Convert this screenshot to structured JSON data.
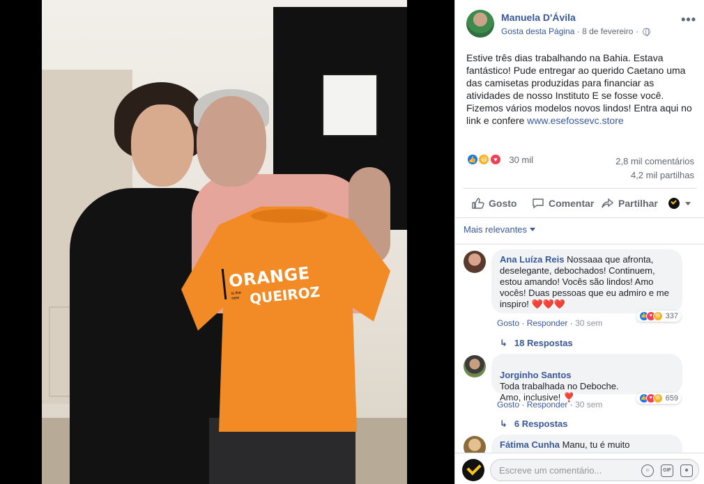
{
  "post": {
    "author": "Manuela D'Ávila",
    "page_action": "Gosta desta Página",
    "date": "8 de fevereiro",
    "text": "Estive três dias trabalhando na Bahia. Estava fantástico! Pude entregar ao querido Caetano uma das camisetas produzidas para financiar as atividades de nosso Instituto E se fosse você. Fizemos vários modelos novos lindos! Entra aqui no link e confere ",
    "link": "www.esefossevc.store",
    "reaction_count": "30 mil",
    "comments_count": "2,8 mil comentários",
    "shares_count": "4,2 mil partilhas",
    "reaction_icons": [
      "like-icon",
      "haha-icon",
      "love-icon"
    ]
  },
  "shirt_print": {
    "line1": "ORANGE",
    "small": "is the new",
    "line2": "QUEIROZ"
  },
  "actions": {
    "like": "Gosto",
    "comment": "Comentar",
    "share": "Partilhar"
  },
  "order_label": "Mais relevantes",
  "comments": [
    {
      "author": "Ana Luíza Reis",
      "text": "Nossaaa que afronta, deselegante, debochados! Continuem, estou amando! Vocês são lindos! Amo vocês! Duas pessoas que eu admiro e me inspiro! ❤️❤️❤️",
      "like": "Gosto",
      "reply": "Responder",
      "time": "30 sem",
      "reactions": "337",
      "replies": "18 Respostas"
    },
    {
      "author": "Jorginho Santos",
      "text": "Toda trabalhada no Deboche.\nAmo, inclusive! ❣️",
      "like": "Gosto",
      "reply": "Responder",
      "time": "30 sem",
      "reactions": "659",
      "replies": "6 Respostas"
    },
    {
      "author": "Fátima Cunha",
      "text": "Manu, tu é muito"
    }
  ],
  "composer": {
    "placeholder": "Escreve um comentário...",
    "gif": "GIF"
  },
  "colors": {
    "link": "#385898",
    "shirt": "#f28a25",
    "like": "#1877f2",
    "love": "#f33e58",
    "haha": "#f7b125"
  }
}
